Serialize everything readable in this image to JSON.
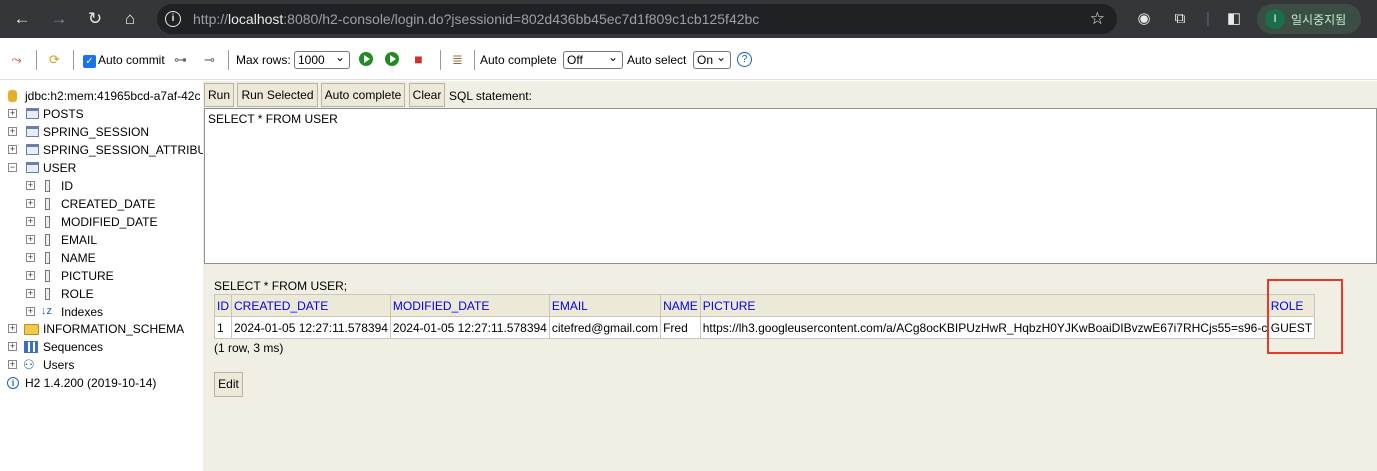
{
  "browser": {
    "url_prefix": "http://",
    "url_host": "localhost",
    "url_rest": ":8080/h2-console/login.do?jsessionid=802d436bb45ec7d1f809c1cb125f42bc",
    "profile_initial": "I",
    "profile_label": "일시중지됨"
  },
  "toolbar": {
    "auto_commit": "Auto commit",
    "max_rows_label": "Max rows:",
    "max_rows_value": "1000",
    "auto_complete_label": "Auto complete",
    "auto_complete_value": "Off",
    "auto_select_label": "Auto select",
    "auto_select_value": "On",
    "help": "?"
  },
  "tree": {
    "connection": "jdbc:h2:mem:41965bcd-a7af-42c",
    "tables": [
      "POSTS",
      "SPRING_SESSION",
      "SPRING_SESSION_ATTRIBUTES",
      "USER"
    ],
    "user_columns": [
      "ID",
      "CREATED_DATE",
      "MODIFIED_DATE",
      "EMAIL",
      "NAME",
      "PICTURE",
      "ROLE"
    ],
    "indexes": "Indexes",
    "information_schema": "INFORMATION_SCHEMA",
    "sequences": "Sequences",
    "users": "Users",
    "version": "H2 1.4.200 (2019-10-14)"
  },
  "editor": {
    "run": "Run",
    "run_selected": "Run Selected",
    "auto_complete": "Auto complete",
    "clear": "Clear",
    "sql_label": "SQL statement:",
    "sql": "SELECT * FROM USER"
  },
  "result": {
    "query": "SELECT * FROM USER;",
    "columns": [
      "ID",
      "CREATED_DATE",
      "MODIFIED_DATE",
      "EMAIL",
      "NAME",
      "PICTURE",
      "ROLE"
    ],
    "rows": [
      [
        "1",
        "2024-01-05 12:27:11.578394",
        "2024-01-05 12:27:11.578394",
        "citefred@gmail.com",
        "Fred",
        "https://lh3.googleusercontent.com/a/ACg8ocKBIPUzHwR_HqbzH0YJKwBoaiDIBvzwE67i7RHCjs55=s96-c",
        "GUEST"
      ]
    ],
    "summary": "(1 row, 3 ms)",
    "edit": "Edit"
  },
  "colors": {
    "highlight": "#e53a2b",
    "panel_bg": "#f1eee3",
    "header_link": "#0000ee"
  }
}
